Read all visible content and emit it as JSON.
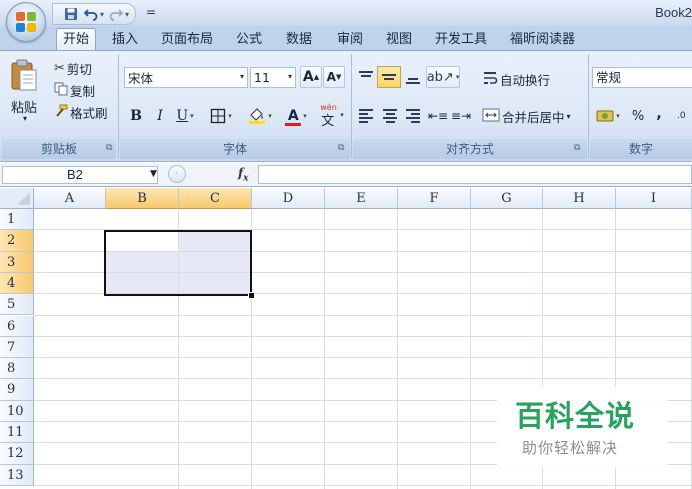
{
  "window": {
    "title": "Book2"
  },
  "qat": {
    "save_icon": "save-icon",
    "undo_icon": "undo-icon",
    "redo_icon": "redo-icon",
    "customize": "="
  },
  "tabs": [
    "开始",
    "插入",
    "页面布局",
    "公式",
    "数据",
    "审阅",
    "视图",
    "开发工具",
    "福昕阅读器"
  ],
  "active_tab": "开始",
  "ribbon": {
    "clipboard": {
      "label": "剪贴板",
      "paste": "粘贴",
      "cut": "剪切",
      "copy": "复制",
      "format_painter": "格式刷"
    },
    "font": {
      "label": "字体",
      "name": "宋体",
      "size": "11",
      "bold": "B",
      "italic": "I",
      "underline": "U",
      "grow": "A",
      "shrink": "A",
      "font_color_letter": "A",
      "phonetic": "wén",
      "phonetic_char": "文"
    },
    "alignment": {
      "label": "对齐方式",
      "wrap_text": "自动换行",
      "merge_center": "合并后居中"
    },
    "number": {
      "label": "数字",
      "format": "常规",
      "percent": "%",
      "comma": ",",
      "decimal": ".0"
    },
    "colors": {
      "accent": "#ffd35e",
      "font_color": "#e0201a",
      "fill_color": "#ffe000"
    }
  },
  "formula_bar": {
    "name_box": "B2",
    "fx": "fx",
    "fx_sub": "x",
    "fx_main": "f",
    "value": ""
  },
  "grid": {
    "columns": [
      "A",
      "B",
      "C",
      "D",
      "E",
      "F",
      "G",
      "H",
      "I"
    ],
    "rows": [
      "1",
      "2",
      "3",
      "4",
      "5",
      "6",
      "7",
      "8",
      "9",
      "10",
      "11",
      "12",
      "13"
    ],
    "selected_columns": [
      "B",
      "C"
    ],
    "selected_rows": [
      "2",
      "3",
      "4"
    ],
    "active_cell": "B2",
    "selection_range": "B2:C4"
  },
  "watermark": {
    "title": "百科全说",
    "subtitle": "助你轻松解决"
  }
}
